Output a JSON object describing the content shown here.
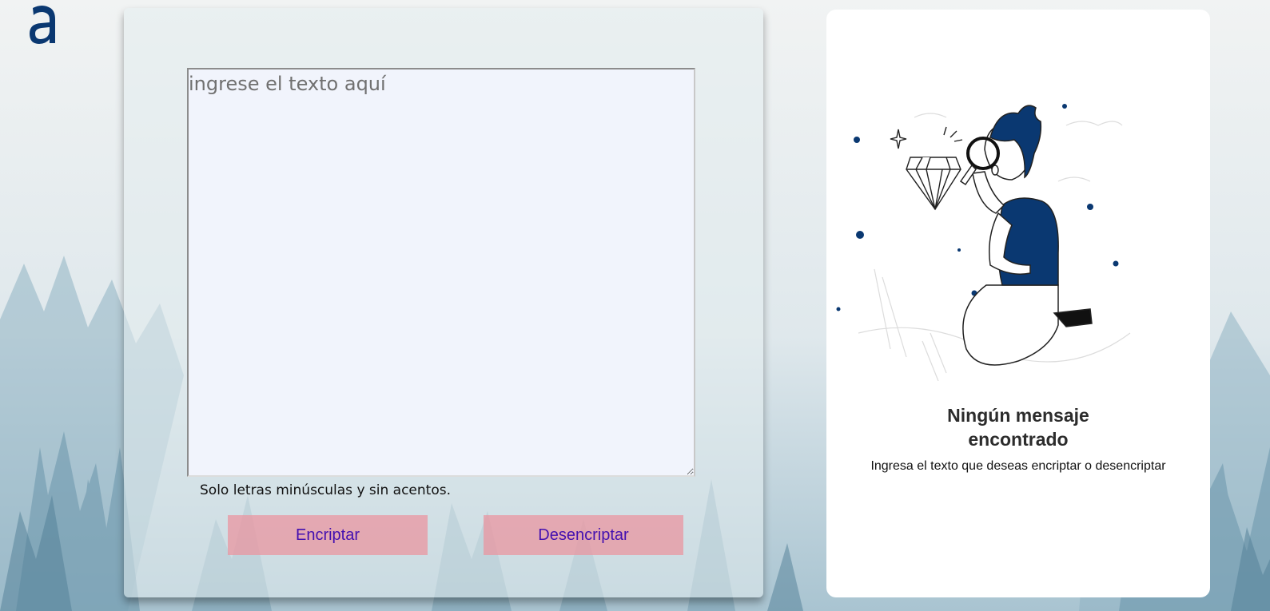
{
  "input": {
    "placeholder": "ingrese el texto aquí",
    "value": ""
  },
  "hint": "Solo letras minúsculas y sin acentos.",
  "buttons": {
    "encrypt": "Encriptar",
    "decrypt": "Desencriptar"
  },
  "output": {
    "title_line1": "Ningún mensaje",
    "title_line2": "encontrado",
    "subtitle": "Ingresa el texto que deseas encriptar o desencriptar"
  },
  "colors": {
    "brand": "#0a3871",
    "button_bg": "#ea96a0",
    "button_text": "#4410b0",
    "textarea_bg": "#f1f4fc"
  },
  "icons": {
    "logo": "alura-logo-icon",
    "illustration": "person-with-magnifier-icon"
  }
}
